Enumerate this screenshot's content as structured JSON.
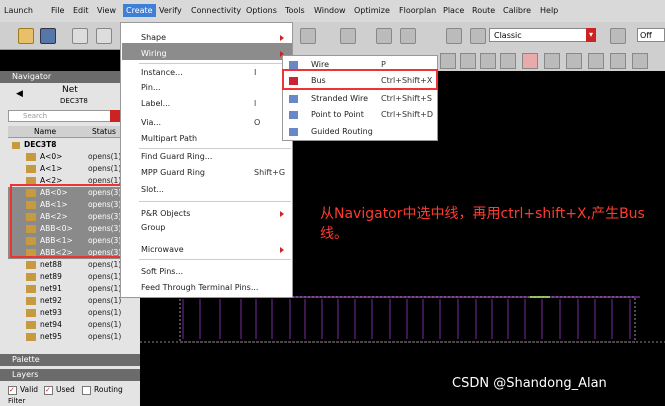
{
  "menubar": {
    "items": [
      "Launch",
      "File",
      "Edit",
      "View",
      "Create",
      "Verify",
      "Connectivity",
      "Options",
      "Tools",
      "Window",
      "Optimize",
      "Floorplan",
      "Place",
      "Route",
      "Calibre",
      "Help"
    ]
  },
  "toolbar": {
    "style_select": "Classic",
    "zoom_field": "Off"
  },
  "navigator": {
    "title": "Navigator",
    "net_label": "Net",
    "cell_name": "DEC3T8",
    "search_placeholder": "Search",
    "col_name": "Name",
    "col_status": "Status",
    "root": "DEC3T8",
    "rows": [
      {
        "name": "A<0>",
        "status": "opens(1)",
        "selected": false
      },
      {
        "name": "A<1>",
        "status": "opens(1)",
        "selected": false
      },
      {
        "name": "A<2>",
        "status": "opens(1)",
        "selected": false
      },
      {
        "name": "AB<0>",
        "status": "opens(3)",
        "selected": true
      },
      {
        "name": "AB<1>",
        "status": "opens(3)",
        "selected": true
      },
      {
        "name": "AB<2>",
        "status": "opens(3)",
        "selected": true
      },
      {
        "name": "ABB<0>",
        "status": "opens(3)",
        "selected": true
      },
      {
        "name": "ABB<1>",
        "status": "opens(3)",
        "selected": true
      },
      {
        "name": "ABB<2>",
        "status": "opens(3)",
        "selected": true
      },
      {
        "name": "net88",
        "status": "opens(1)",
        "selected": false
      },
      {
        "name": "net89",
        "status": "opens(1)",
        "selected": false
      },
      {
        "name": "net91",
        "status": "opens(1)",
        "selected": false
      },
      {
        "name": "net92",
        "status": "opens(1)",
        "selected": false
      },
      {
        "name": "net93",
        "status": "opens(1)",
        "selected": false
      },
      {
        "name": "net94",
        "status": "opens(1)",
        "selected": false
      },
      {
        "name": "net95",
        "status": "opens(1)",
        "selected": false
      }
    ]
  },
  "palette": {
    "title": "Palette"
  },
  "layers": {
    "title": "Layers",
    "valid": "Valid",
    "used": "Used",
    "routing": "Routing",
    "filter_label": "Filter"
  },
  "create_menu": {
    "items": [
      {
        "label": "Shape",
        "shortcut": "",
        "submenu": true
      },
      {
        "label": "Wiring",
        "shortcut": "",
        "submenu": true,
        "highlighted": true
      },
      {
        "label": "Instance...",
        "shortcut": "I",
        "submenu": false
      },
      {
        "label": "Pin...",
        "shortcut": "",
        "submenu": false
      },
      {
        "label": "Label...",
        "shortcut": "l",
        "submenu": false
      },
      {
        "label": "Via...",
        "shortcut": "O",
        "submenu": false
      },
      {
        "label": "Multipart Path",
        "shortcut": "",
        "submenu": false
      },
      {
        "label": "Find Guard Ring...",
        "shortcut": "",
        "submenu": false
      },
      {
        "label": "MPP Guard Ring",
        "shortcut": "Shift+G",
        "submenu": false
      },
      {
        "label": "Slot...",
        "shortcut": "",
        "submenu": false
      },
      {
        "label": "P&R Objects",
        "shortcut": "",
        "submenu": true
      },
      {
        "label": "Group",
        "shortcut": "",
        "submenu": false
      },
      {
        "label": "Microwave",
        "shortcut": "",
        "submenu": true
      },
      {
        "label": "Soft Pins...",
        "shortcut": "",
        "submenu": false
      },
      {
        "label": "Feed Through Terminal Pins...",
        "shortcut": "",
        "submenu": false
      }
    ]
  },
  "wiring_menu": {
    "items": [
      {
        "label": "Wire",
        "shortcut": "P"
      },
      {
        "label": "Bus",
        "shortcut": "Ctrl+Shift+X",
        "highlighted": true
      },
      {
        "label": "Stranded Wire",
        "shortcut": "Ctrl+Shift+S"
      },
      {
        "label": "Point to Point",
        "shortcut": "Ctrl+Shift+D"
      },
      {
        "label": "Guided Routing",
        "shortcut": ""
      }
    ]
  },
  "annotation": "从Navigator中选中线，再用ctrl+shift+X,产生Bus线。",
  "watermark": "CSDN @Shandong_Alan",
  "colors": {
    "accent": "#3f7fd6",
    "highlight_border": "#e33333",
    "annotation": "#ff3b30",
    "wire_purple": "#7a2aa0",
    "wire_green": "#8fd14f"
  }
}
